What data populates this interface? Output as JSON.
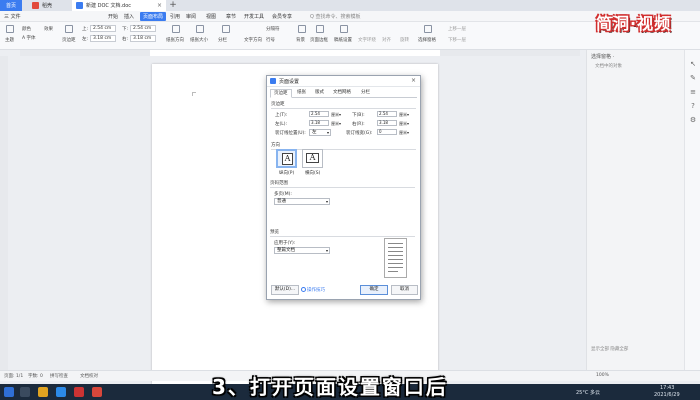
{
  "tabs": {
    "home": "首页",
    "t2": "稻壳",
    "doc": "新建 DOC 文档.doc"
  },
  "menu": {
    "file": "三 文件",
    "items": [
      "开始",
      "插入",
      "页面布局",
      "引用",
      "审阅",
      "视图",
      "章节",
      "开发工具",
      "会员专享"
    ],
    "search": "Q 查找命令、搜索模板"
  },
  "ribbon": {
    "theme": "主题",
    "color": "颜色",
    "font": "A 字体",
    "effect": "效果",
    "margins": "页边距",
    "top_label": "上:",
    "top_val": "2.54 cm",
    "bottom_label": "下:",
    "bottom_val": "2.54 cm",
    "left_label": "左:",
    "left_val": "3.18 cm",
    "right_label": "右:",
    "right_val": "3.18 cm",
    "orientation": "纸张方向",
    "size": "纸张大小",
    "columns": "分栏",
    "text_direction": "文字方向",
    "line_number": "行号",
    "breaks": "分隔符",
    "background": "背景",
    "page_border": "页面边框",
    "manuscript": "稿纸设置",
    "wrap": "文字环绕",
    "align": "对齐",
    "rotate": "旋转",
    "select_pane": "选择窗格",
    "up": "上移一层",
    "down": "下移一层"
  },
  "logo": "简洞·视频",
  "dialog": {
    "title": "页面设置",
    "close": "×",
    "tabs": [
      "页边距",
      "纸张",
      "版式",
      "文档网格",
      "分栏"
    ],
    "margins_section": "页边距",
    "top_label": "上(T):",
    "top_value": "2.54",
    "bottom_label": "下(B):",
    "bottom_value": "2.54",
    "left_label": "左(L):",
    "left_value": "3.18",
    "right_label": "右(R):",
    "right_value": "3.18",
    "unit": "厘米▾",
    "gutter_pos_label": "装订线位置(U):",
    "gutter_pos_value": "左",
    "gutter_width_label": "装订线宽(G):",
    "gutter_width_value": "0",
    "orientation_section": "方向",
    "portrait": "纵向(P)",
    "landscape": "横向(S)",
    "pages_section": "页码范围",
    "multiple_pages_label": "多页(M):",
    "multiple_pages_value": "普通",
    "preview_section": "预览",
    "apply_to_label": "应用于(Y):",
    "apply_to_value": "整篇文档",
    "default_button": "默认(D)...",
    "tips": "操作技巧",
    "ok": "确定",
    "cancel": "取消"
  },
  "right_panel": {
    "title": "选择窗格 ·",
    "subtitle": "文档中的对象",
    "footer": "显示全部    隐藏全部"
  },
  "status": {
    "page": "页面: 1/1",
    "words": "字数: 0",
    "spell": "拼写检查",
    "doc_check": "文档校对",
    "zoom": "100%"
  },
  "taskbar": {
    "weather": "25°C 多云",
    "time": "17:43",
    "date": "2021/6/29"
  },
  "caption": "3、打开页面设置窗口后"
}
